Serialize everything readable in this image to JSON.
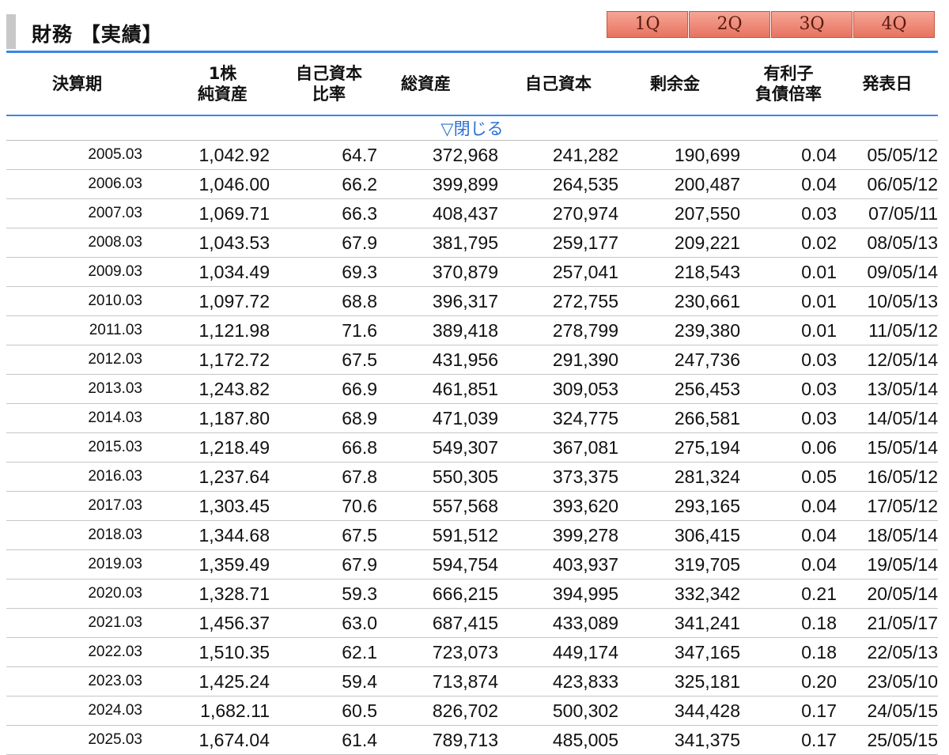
{
  "section": {
    "title": "財務 【実績】",
    "quarter_tabs": [
      "1Q",
      "2Q",
      "3Q",
      "4Q"
    ]
  },
  "table": {
    "headers": [
      [
        "決算期"
      ],
      [
        "1株",
        "純資産"
      ],
      [
        "自己資本",
        "比率"
      ],
      [
        "総資産"
      ],
      [
        "自己資本"
      ],
      [
        "剰余金"
      ],
      [
        "有利子",
        "負債倍率"
      ],
      [
        "発表日"
      ]
    ],
    "toggle_label": "▽閉じる",
    "rows": [
      [
        "2005.03",
        "1,042.92",
        "64.7",
        "372,968",
        "241,282",
        "190,699",
        "0.04",
        "05/05/12"
      ],
      [
        "2006.03",
        "1,046.00",
        "66.2",
        "399,899",
        "264,535",
        "200,487",
        "0.04",
        "06/05/12"
      ],
      [
        "2007.03",
        "1,069.71",
        "66.3",
        "408,437",
        "270,974",
        "207,550",
        "0.03",
        "07/05/11"
      ],
      [
        "2008.03",
        "1,043.53",
        "67.9",
        "381,795",
        "259,177",
        "209,221",
        "0.02",
        "08/05/13"
      ],
      [
        "2009.03",
        "1,034.49",
        "69.3",
        "370,879",
        "257,041",
        "218,543",
        "0.01",
        "09/05/14"
      ],
      [
        "2010.03",
        "1,097.72",
        "68.8",
        "396,317",
        "272,755",
        "230,661",
        "0.01",
        "10/05/13"
      ],
      [
        "2011.03",
        "1,121.98",
        "71.6",
        "389,418",
        "278,799",
        "239,380",
        "0.01",
        "11/05/12"
      ],
      [
        "2012.03",
        "1,172.72",
        "67.5",
        "431,956",
        "291,390",
        "247,736",
        "0.03",
        "12/05/14"
      ],
      [
        "2013.03",
        "1,243.82",
        "66.9",
        "461,851",
        "309,053",
        "256,453",
        "0.03",
        "13/05/14"
      ],
      [
        "2014.03",
        "1,187.80",
        "68.9",
        "471,039",
        "324,775",
        "266,581",
        "0.03",
        "14/05/14"
      ],
      [
        "2015.03",
        "1,218.49",
        "66.8",
        "549,307",
        "367,081",
        "275,194",
        "0.06",
        "15/05/14"
      ],
      [
        "2016.03",
        "1,237.64",
        "67.8",
        "550,305",
        "373,375",
        "281,324",
        "0.05",
        "16/05/12"
      ],
      [
        "2017.03",
        "1,303.45",
        "70.6",
        "557,568",
        "393,620",
        "293,165",
        "0.04",
        "17/05/12"
      ],
      [
        "2018.03",
        "1,344.68",
        "67.5",
        "591,512",
        "399,278",
        "306,415",
        "0.04",
        "18/05/14"
      ],
      [
        "2019.03",
        "1,359.49",
        "67.9",
        "594,754",
        "403,937",
        "319,705",
        "0.04",
        "19/05/14"
      ],
      [
        "2020.03",
        "1,328.71",
        "59.3",
        "666,215",
        "394,995",
        "332,342",
        "0.21",
        "20/05/14"
      ],
      [
        "2021.03",
        "1,456.37",
        "63.0",
        "687,415",
        "433,089",
        "341,241",
        "0.18",
        "21/05/17"
      ],
      [
        "2022.03",
        "1,510.35",
        "62.1",
        "723,073",
        "449,174",
        "347,165",
        "0.18",
        "22/05/13"
      ],
      [
        "2023.03",
        "1,425.24",
        "59.4",
        "713,874",
        "423,833",
        "325,181",
        "0.20",
        "23/05/10"
      ],
      [
        "2024.03",
        "1,682.11",
        "60.5",
        "826,702",
        "500,302",
        "344,428",
        "0.17",
        "24/05/15"
      ],
      [
        "2025.03",
        "1,674.04",
        "61.4",
        "789,713",
        "485,005",
        "341,375",
        "0.17",
        "25/05/15"
      ]
    ]
  },
  "colors": {
    "accent_blue": "#3a86e8",
    "tab_fill": "#ec8a78",
    "toggle_link": "#2a6fd6"
  }
}
